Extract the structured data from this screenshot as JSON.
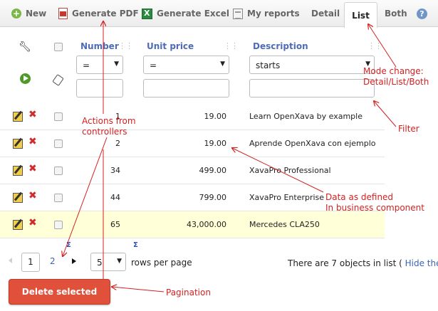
{
  "toolbar": {
    "new_label": "New",
    "pdf_label": "Generate PDF",
    "excel_label": "Generate Excel",
    "reports_label": "My reports",
    "tab_detail": "Detail",
    "tab_list": "List",
    "tab_both": "Both",
    "active_tab": "List",
    "help_glyph": "?"
  },
  "columns": {
    "number": {
      "header": "Number",
      "operator": "=",
      "filter_value": ""
    },
    "unit_price": {
      "header": "Unit price",
      "operator": "=",
      "filter_value": ""
    },
    "description": {
      "header": "Description",
      "operator": "starts",
      "filter_value": ""
    }
  },
  "rows": [
    {
      "number": "1",
      "unit_price": "19.00",
      "description": "Learn OpenXava by example"
    },
    {
      "number": "2",
      "unit_price": "19.00",
      "description": "Aprende OpenXava con ejemplo"
    },
    {
      "number": "34",
      "unit_price": "499.00",
      "description": "XavaPro Professional"
    },
    {
      "number": "44",
      "unit_price": "799.00",
      "description": "XavaPro Enterprise"
    },
    {
      "number": "65",
      "unit_price": "43,000.00",
      "description": "Mercedes CLA250"
    }
  ],
  "pagination": {
    "current_page": "1",
    "next_page": "2",
    "rows_per_page": "5",
    "rows_per_page_label": "rows per page",
    "sum_symbol": "Σ",
    "count_text": "There are 7 objects in list (",
    "hide_link": "Hide them",
    "count_close": ")"
  },
  "delete_button_label": "Delete selected rows",
  "annotations": {
    "actions": "Actions from\ncontrollers",
    "mode_change": "Mode change:\nDetail/List/Both",
    "filter": "Filter",
    "data": "Data as defined\nIn business component",
    "pagination": "Pagination"
  },
  "colors": {
    "accent": "#4f6bb6",
    "annotation": "#d42020",
    "highlight_row": "#ffffd8",
    "delete_button": "#e0503a"
  },
  "icons": [
    "new-icon",
    "pdf-icon",
    "excel-icon",
    "reports-icon",
    "help-icon",
    "wrench-icon",
    "play-icon",
    "eraser-icon",
    "edit-icon",
    "delete-icon"
  ]
}
